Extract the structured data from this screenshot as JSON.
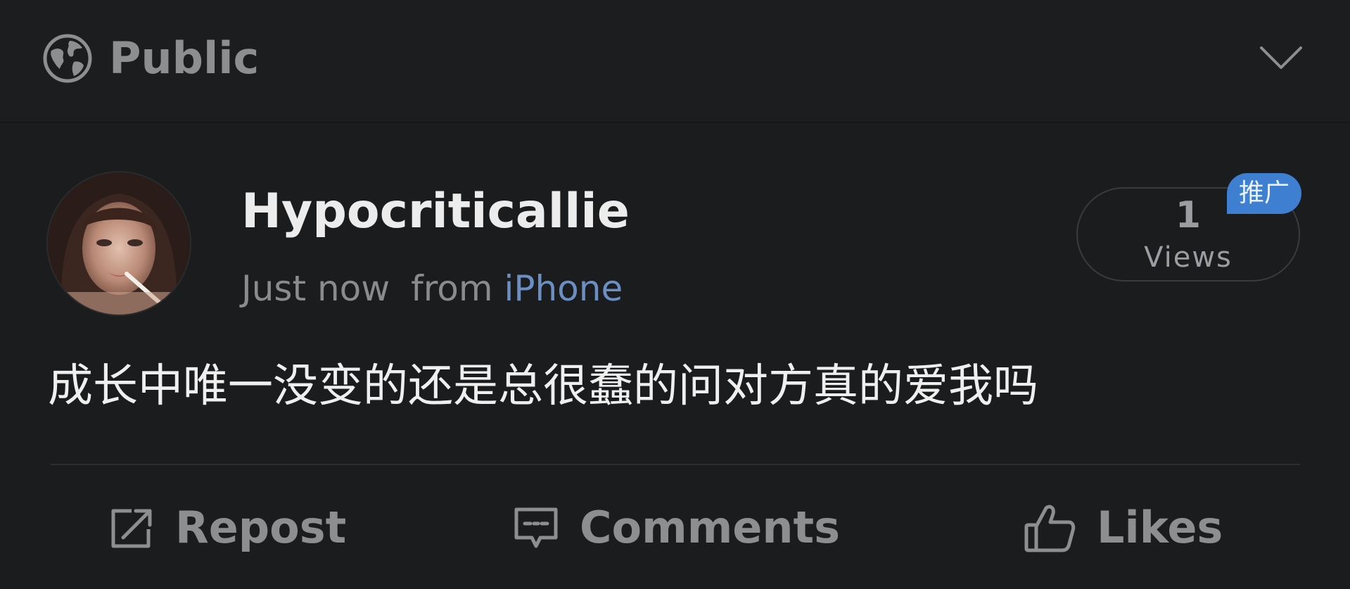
{
  "header": {
    "visibility_label": "Public",
    "visibility_icon": "globe-icon",
    "expand_icon": "chevron-down-icon"
  },
  "post": {
    "author": {
      "name": "Hypocriticallie"
    },
    "timestamp": "Just now",
    "source_prefix": "from",
    "source_device": "iPhone",
    "views": {
      "count": "1",
      "label": "Views"
    },
    "promo_badge": "推广",
    "text": "成长中唯一没变的还是总很蠢的问对方真的爱我吗"
  },
  "actions": [
    {
      "label": "Repost",
      "icon": "repost-icon"
    },
    {
      "label": "Comments",
      "icon": "comment-icon"
    },
    {
      "label": "Likes",
      "icon": "thumbs-up-icon"
    }
  ],
  "colors": {
    "background": "#1b1c1e",
    "link": "#6b8fc4",
    "badge": "#3e7fd1",
    "muted_text": "#8d8e90"
  }
}
